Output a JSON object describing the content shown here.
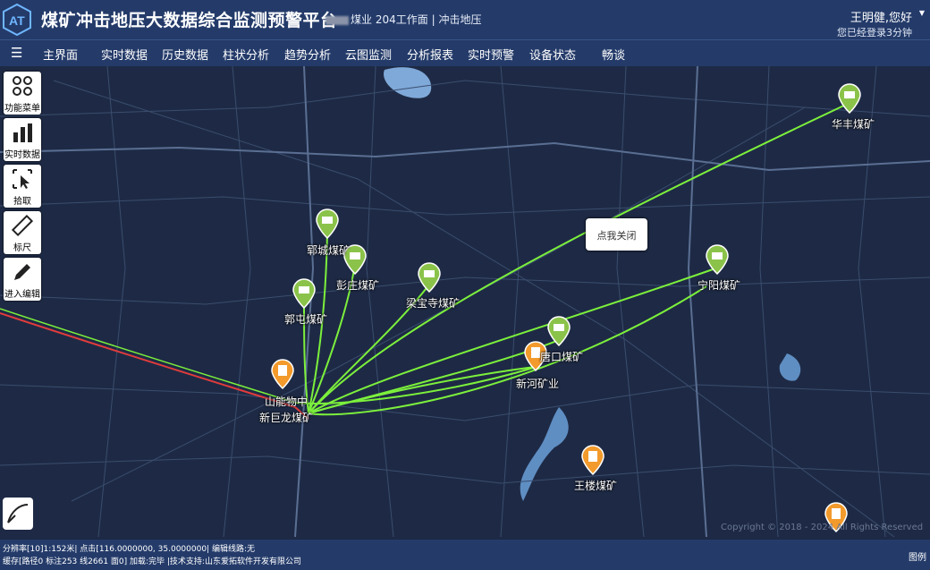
{
  "header": {
    "title": "煤矿冲击地压大数据综合监测预警平台",
    "mine": "煤业 204工作面",
    "separator": "|",
    "module": "冲击地压",
    "greeting": "王明健,您好",
    "login_time": "您已经登录3分钟"
  },
  "nav": {
    "items": [
      "主界面",
      "实时数据",
      "历史数据",
      "柱状分析",
      "趋势分析",
      "云图监测",
      "分析报表",
      "实时预警",
      "设备状态",
      "畅谈"
    ]
  },
  "tools": [
    {
      "label": "功能菜单",
      "icon": "grid-icon"
    },
    {
      "label": "实时数据",
      "icon": "bar-chart-icon"
    },
    {
      "label": "拾取",
      "icon": "cursor-select-icon"
    },
    {
      "label": "标尺",
      "icon": "ruler-icon"
    },
    {
      "label": "进入编辑",
      "icon": "pencil-icon"
    }
  ],
  "popup": {
    "text": "点我关闭"
  },
  "mines": {
    "huafeng": "华丰煤矿",
    "yuncheng": "郓城煤矿",
    "pengzhuang": "彭庄煤矿",
    "liangbaosi": "梁宝寺煤矿",
    "guotun": "郭屯煤矿",
    "ningyang": "宁阳煤矿",
    "tangkou": "唐口煤矿",
    "xinhe": "新河矿业",
    "shanxian": "山能物中",
    "xinjulong": "新巨龙煤矿",
    "wanglou": "王楼煤矿"
  },
  "status": {
    "line1": "分辨率[10]1:152米| 点击[116.0000000, 35.0000000| 编辑线路:无",
    "line2": "缓存[路径0 标注253 线2661 面0] 加载:完毕 |技术支持:山东爱拓软件开发有限公司",
    "legend": "图例"
  },
  "copyright": "Copyright © 2018 - 2024 All Rights Reserved",
  "colors": {
    "header": "#243b6a",
    "map": "#1e2a45",
    "link_line": "#7cf03c",
    "route_red": "#e23c3c",
    "marker_green": "#8bc34a",
    "marker_orange": "#f39a2c"
  }
}
